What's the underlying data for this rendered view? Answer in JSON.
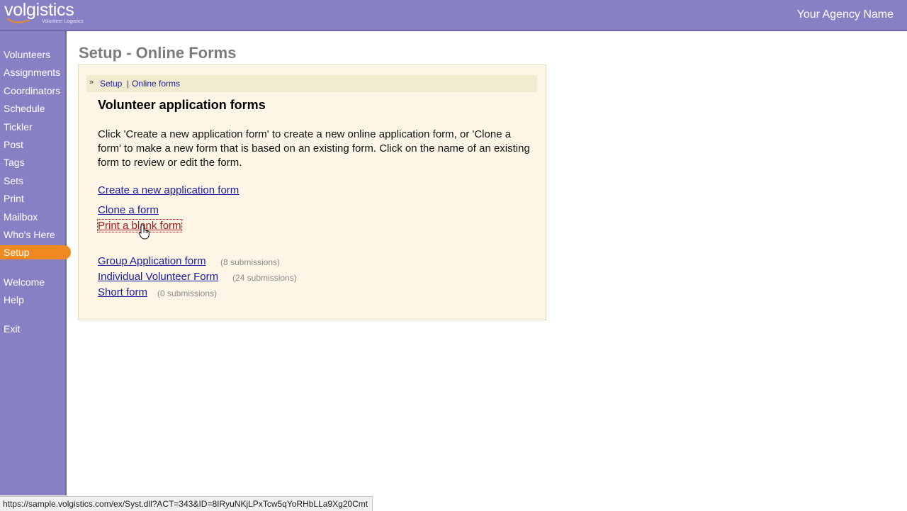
{
  "header": {
    "logo_text": "volgistics",
    "logo_tagline": "Volunteer Logistics",
    "agency_name": "Your Agency Name"
  },
  "sidebar": {
    "items": [
      {
        "label": "Volunteers"
      },
      {
        "label": "Assignments"
      },
      {
        "label": "Coordinators"
      },
      {
        "label": "Schedule"
      },
      {
        "label": "Tickler"
      },
      {
        "label": "Post"
      },
      {
        "label": "Tags"
      },
      {
        "label": "Sets"
      },
      {
        "label": "Print"
      },
      {
        "label": "Mailbox"
      },
      {
        "label": "Who's Here"
      },
      {
        "label": "Setup",
        "active": true
      }
    ],
    "secondary": [
      {
        "label": "Welcome"
      },
      {
        "label": "Help"
      }
    ],
    "exit_label": "Exit"
  },
  "main": {
    "page_title": "Setup - Online Forms",
    "breadcrumb": {
      "arrow": "»",
      "setup": "Setup",
      "separator": "|",
      "current": "Online forms"
    },
    "section_title": "Volunteer application forms",
    "description": "Click 'Create a new application form' to create a new online application form, or 'Clone a form' to make a new form that is based on an existing form. Click on the name of an existing form to review or edit the form.",
    "actions": {
      "create": "Create a new application form",
      "clone": "Clone a form",
      "print_blank": "Print a blank form"
    },
    "forms": [
      {
        "name": "Group Application form",
        "submissions": "(8 submissions)"
      },
      {
        "name": "Individual Volunteer Form",
        "submissions": "(24 submissions)"
      },
      {
        "name": "Short form",
        "submissions": "(0 submissions)"
      }
    ]
  },
  "statusbar": {
    "url": "https://sample.volgistics.com/ex/Syst.dll?ACT=343&ID=8IRyuNKjLPxTcw5qYoRHbLLa9Xg20Cmt"
  },
  "colors": {
    "header_bg": "#8880c4",
    "active_nav": "#f08a20",
    "panel_bg": "#fdf6e6",
    "link": "#1a1aa0",
    "link_hover": "#aa1111"
  }
}
